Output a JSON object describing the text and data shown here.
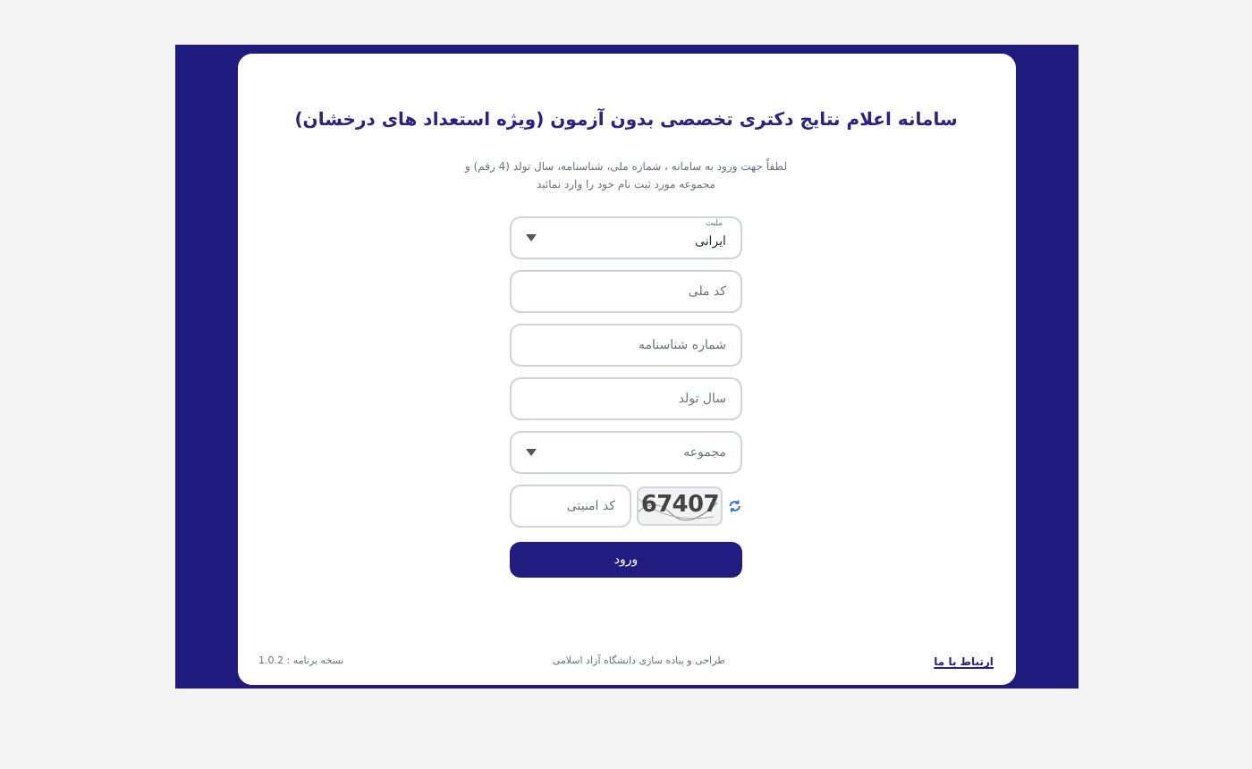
{
  "title": "سامانه اعلام نتایج دکتری تخصصی بدون آزمون (ویژه استعداد های درخشان)",
  "intro": "لطفاً جهت ورود به سامانه ، شماره ملی، شناسنامه، سال تولد (4 رقم) و مجموعه مورد ثبت نام خود را وارد نمائید",
  "fields": [
    {
      "kind": "select",
      "label": "ملیت",
      "value": "ایرانی"
    },
    {
      "kind": "input",
      "placeholder": "کد ملی"
    },
    {
      "kind": "input",
      "placeholder": "شماره شناسنامه"
    },
    {
      "kind": "input",
      "placeholder": "سال تولد"
    },
    {
      "kind": "select",
      "placeholder": "مجموعه"
    },
    {
      "kind": "captcha",
      "placeholder": "کد امنیتی",
      "code": "67407"
    }
  ],
  "submit": "ورود",
  "footer": {
    "contact": "ارتباط با ما",
    "credit": "طراحی و پیاده سازی دانشگاه آزاد اسلامی",
    "version": "نسخه برنامه : 1.0.2"
  }
}
